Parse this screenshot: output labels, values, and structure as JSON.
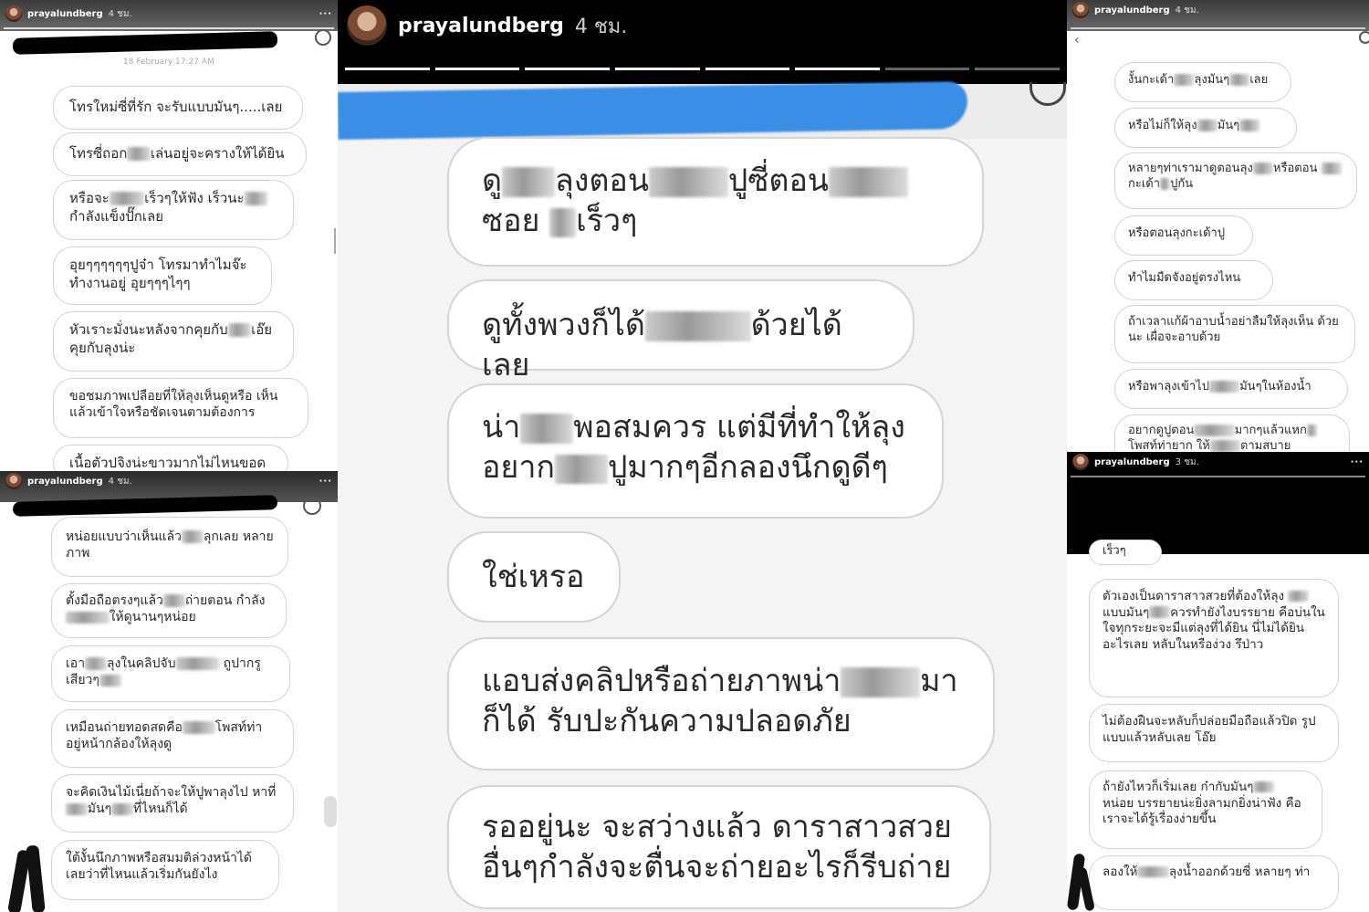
{
  "panels": {
    "tl": {
      "user": "prayalundberg",
      "time": "4 ชม.",
      "dots": "···",
      "date_fragment": "18 February 17:27 AM",
      "msgs": [
        "โทรใหม่ซี่ที่รัก จะรับแบบมันๆ.....เลย",
        "โทรซี่ถอก■■เล่นอยู่จะครางให้ได้ยิน",
        "หรือจะ■■■เร็วๆให้ฟัง เร็วนะ■■ กำลังแข็งปั๊กเลย",
        "อุยๆๆๆๆๆๆปูจ๋า โทรมาทำไมจ๊ะ ทำงานอยู่ อุยๆๆๆไๆๆ",
        "หัวเราะมั่งนะหลังจากคุยกับ■■เอ๊ย คุยกับลุงน่ะ",
        "ขอชมภาพเปลือยที่ให้ลุงเห็นดูหรือ เห็นแล้วเข้าใจหรือชัดเจนตามต้องการ",
        "เนื้อตัวปจิงน่ะขาวมากไม่ไหนขอด"
      ]
    },
    "bl": {
      "user": "prayalundberg",
      "time": "4 ชม.",
      "dots": "···",
      "msgs": [
        "หน่อยแบบว่าเห็นแล้ว■■ลุกเลย หลายภาพ",
        "ตั้งมือถือตรงๆแล้ว■■ถ่ายตอน กำลัง■■■■ให้ดูนานๆหน่อย",
        "เอา■■ลุงในคลิปจับ■■■■ ถูปากรูเสียวๆ■■",
        "เหมือนถ่ายทอดสดคือ■■■โพสท์ท่า อยู่หน้ากล้องให้ลุงดู",
        "จะคิดเงินไม้เนี่ยถ้าจะให้ปูพาลุงไป หาที่■■มันๆ■■ที่ไหนก็ได้",
        "ใต้งั้นนึกภาพหรือสมมติล่วงหน้าได้ เลยว่าที่ไหนแล้วเริ่มกันยังไง"
      ]
    },
    "c": {
      "user": "prayalundberg",
      "time": "4 ชม.",
      "msgs": [
        "ดู■■ลุงตอน■■■ปูซี่ตอน■■■ซอย ■เร็วๆ",
        "ดูทั้งพวงก็ได้■■■■ด้วยได้เลย",
        "น่า■■พอสมควร แต่มีที่ทำให้ลุง อยาก■■ปูมากๆอีกลองนึกดูดีๆ",
        "ใช่เหรอ",
        "แอบส่งคลิปหรือถ่ายภาพน่า■■■มา ก็ได้ รับปะกันความปลอดภัย",
        "รออยู่นะ จะสว่างแล้ว ดาราสาวสวย อื่นๆกำลังจะตื่นจะถ่ายอะไรก็รีบถ่าย"
      ]
    },
    "tr": {
      "user": "prayalundberg",
      "time": "4 ชม.",
      "msgs": [
        "งั้นกะเด้า■■ลุงมันๆ■■เลย",
        "หรือไม่ก็ให้ลุง■■มันๆ■■",
        "หลายๆท่าเรามาดูตอนลุง■■หรือตอน ■■กะเด้า■ปูกัน",
        "หรือตอนลุงกะเด้าปู",
        "ทำไมมืดจังอยู่ตรงไหน",
        "ถ้าเวลาแก้ผ้าอาบน้ำอย่าลืมให้ลุงเห็น ด้วยนะ เผื่อจะอาบด้วย",
        "หรือพาลุงเข้าไป■■■มันๆในห้องน้ำ",
        "อยากดูปูตอน■■■■มากๆแล้วแหก■ โพสท์ท่ายาก ให้■■■ตามสบาย"
      ]
    },
    "br": {
      "user": "prayalundberg",
      "time": "3 ชม.",
      "dots": "···",
      "msgs": [
        "เร็วๆ",
        "ตัวเองเป็นดาราสาวสวยที่ต้องให้ลุง ■■แบบมันๆ■■ควรทำยังไงบรรยาย คือบ่นในใจทุกระยะจะมีแต่ลุงที่ได้ยิน นี่ไม่ได้ยินอะไรเลย หลับในหรือง่วง รึป่าว",
        "ไม่ต้องฝืนจะหลับก็ปล่อยมือถือแล้วปิด รูปแบบแล้วหลับเลย โอ๊ย",
        "ถ้ายังไหวก็เริ่มเลย ก๋ากับมันๆ■■ หน่อย บรรยายน่ะยิ่งลามกยิ่งน่าฟัง คือเราจะได้รู้เรื่องง่ายขึ้น",
        "ลองให้■■■ลุงน้ำออกด้วยซี่ หลายๆ ท่า"
      ]
    }
  },
  "colors": {
    "header_black": "#000000",
    "redaction_blue": "#3b8ee6",
    "bubble_border": "#d4d4d4"
  }
}
